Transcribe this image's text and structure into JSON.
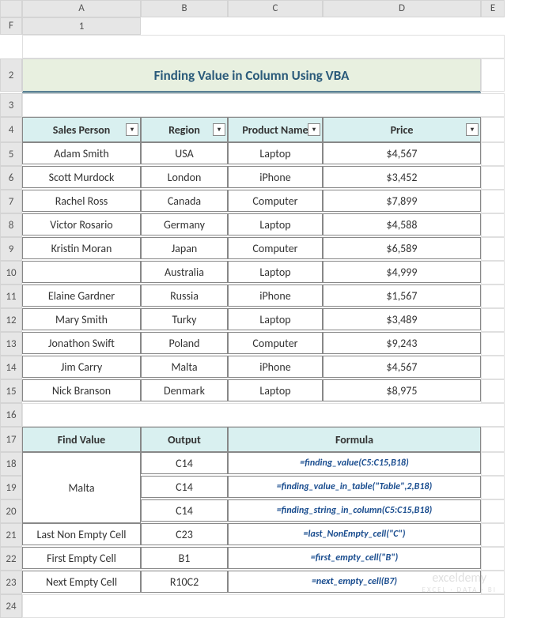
{
  "columns": [
    "A",
    "B",
    "C",
    "D",
    "E",
    "F"
  ],
  "rows": [
    1,
    2,
    3,
    4,
    5,
    6,
    7,
    8,
    9,
    10,
    11,
    12,
    13,
    14,
    15,
    16,
    17,
    18,
    19,
    20,
    21,
    22,
    23,
    24
  ],
  "title": "Finding Value in Column Using VBA",
  "table1": {
    "headers": [
      "Sales Person",
      "Region",
      "Product Name",
      "Price"
    ],
    "rows": [
      [
        "Adam Smith",
        "USA",
        "Laptop",
        "$4,567"
      ],
      [
        "Scott Murdock",
        "London",
        "iPhone",
        "$3,452"
      ],
      [
        "Rachel Ross",
        "Canada",
        "Computer",
        "$7,899"
      ],
      [
        "Victor Rosario",
        "Germany",
        "Laptop",
        "$4,588"
      ],
      [
        "Kristin Moran",
        "Japan",
        "Computer",
        "$6,589"
      ],
      [
        "",
        "Australia",
        "Laptop",
        "$4,999"
      ],
      [
        "Elaine Gardner",
        "Russia",
        "iPhone",
        "$1,567"
      ],
      [
        "Mary Smith",
        "Turky",
        "Laptop",
        "$3,489"
      ],
      [
        "Jonathon Swift",
        "Poland",
        "Computer",
        "$9,243"
      ],
      [
        "Jim Carry",
        "Malta",
        "iPhone",
        "$4,567"
      ],
      [
        "Nick Branson",
        "Denmark",
        "Laptop",
        "$8,975"
      ]
    ]
  },
  "table2": {
    "headers": [
      "Find Value",
      "Output",
      "Formula"
    ],
    "malta_value": "Malta",
    "rows": [
      {
        "output": "C14",
        "formula": "=finding_value(C5:C15,B18)"
      },
      {
        "output": "C14",
        "formula": "=finding_value_in_table(\"Table\",2,B18)"
      },
      {
        "output": "C14",
        "formula": "=finding_string_in_column(C5:C15,B18)"
      },
      {
        "find": "Last Non Empty Cell",
        "output": "C23",
        "formula": "=last_NonEmpty_cell(\"C\")"
      },
      {
        "find": "First Empty Cell",
        "output": "B1",
        "formula": "=first_empty_cell(\"B\")"
      },
      {
        "find": "Next Empty Cell",
        "output": "R10C2",
        "formula": "=next_empty_cell(B7)"
      }
    ]
  },
  "watermark": {
    "main": "exceldemy",
    "sub": "EXCEL · DATA · BI"
  }
}
